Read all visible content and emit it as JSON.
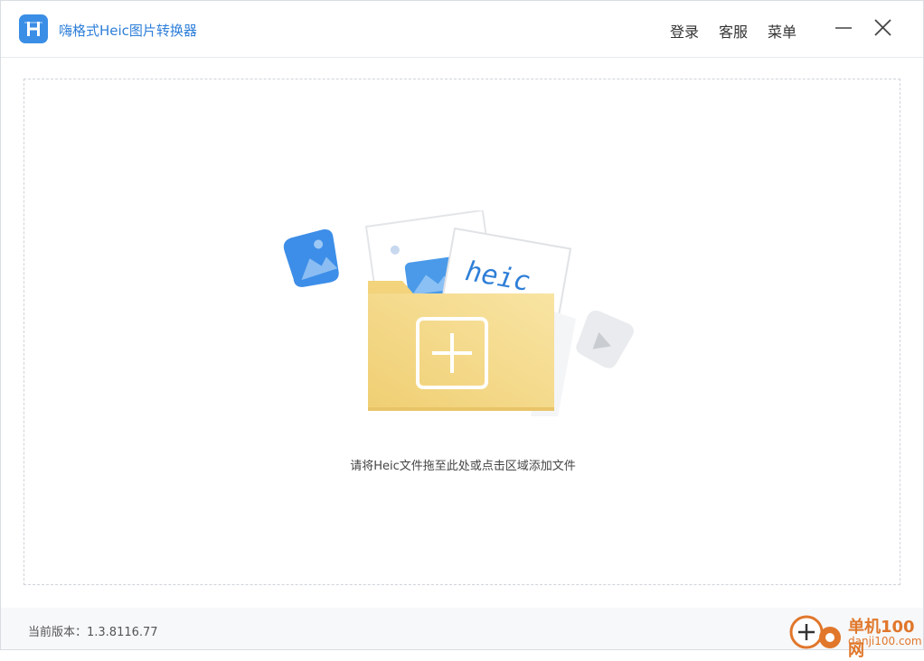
{
  "app": {
    "title": "嗨格式Heic图片转换器",
    "logo_letter": "H"
  },
  "header": {
    "login_label": "登录",
    "service_label": "客服",
    "menu_label": "菜单"
  },
  "dropzone": {
    "hint": "请将Heic文件拖至此处或点击区域添加文件",
    "card_text": "heic"
  },
  "footer": {
    "version_label": "当前版本：1.3.8116.77"
  },
  "watermark": {
    "name": "单机100网",
    "url": "danji100.com"
  },
  "colors": {
    "brand": "#3a8ee6",
    "title_text": "#2e7fd9",
    "folder": "#f5d98a",
    "watermark": "#e0772b"
  }
}
